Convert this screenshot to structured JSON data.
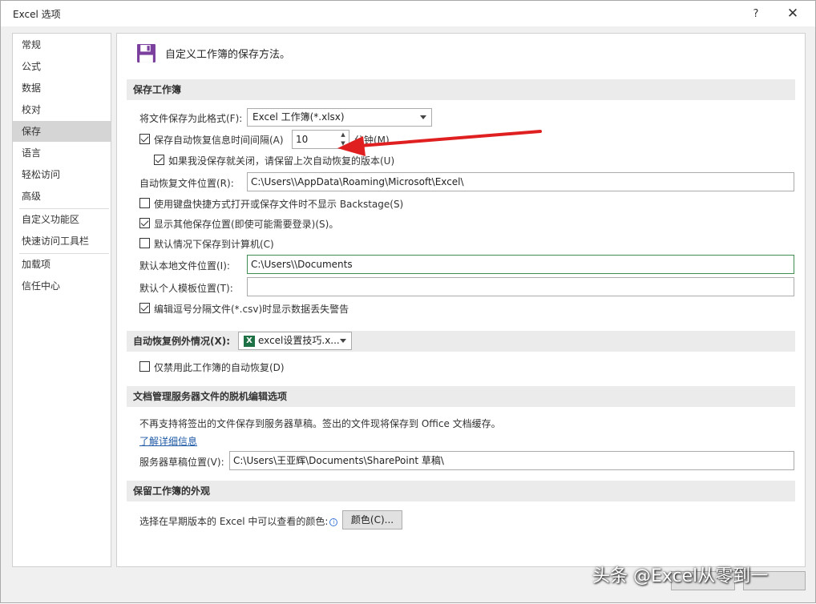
{
  "window": {
    "title": "Excel 选项",
    "help_label": "?",
    "close_label": "✕"
  },
  "nav": {
    "items": [
      {
        "label": "常规"
      },
      {
        "label": "公式"
      },
      {
        "label": "数据"
      },
      {
        "label": "校对"
      },
      {
        "label": "保存",
        "active": true
      },
      {
        "label": "语言"
      },
      {
        "label": "轻松访问"
      },
      {
        "label": "高级"
      },
      {
        "label": "自定义功能区"
      },
      {
        "label": "快速访问工具栏"
      },
      {
        "label": "加载项"
      },
      {
        "label": "信任中心"
      }
    ]
  },
  "main": {
    "heading": "自定义工作簿的保存方法。",
    "save_workbooks": {
      "title": "保存工作簿",
      "format_label": "将文件保存为此格式(F):",
      "format_value": "Excel 工作簿(*.xlsx)",
      "autorecover_label": "保存自动恢复信息时间间隔(A)",
      "autorecover_checked": true,
      "autorecover_minutes": "10",
      "minutes_label": "分钟(M)",
      "keep_last_label": "如果我没保存就关闭，请保留上次自动恢复的版本(U)",
      "keep_last_checked": true,
      "autorecover_location_label": "自动恢复文件位置(R):",
      "autorecover_location_value": "C:\\Users\\\\AppData\\Roaming\\Microsoft\\Excel\\",
      "no_backstage_label": "使用键盘快捷方式打开或保存文件时不显示 Backstage(S)",
      "no_backstage_checked": false,
      "show_additional_label": "显示其他保存位置(即使可能需要登录)(S)。",
      "show_additional_checked": true,
      "save_to_computer_label": "默认情况下保存到计算机(C)",
      "save_to_computer_checked": false,
      "default_local_label": "默认本地文件位置(I):",
      "default_local_value": "C:\\Users\\\\Documents",
      "default_template_label": "默认个人模板位置(T):",
      "default_template_value": "",
      "csv_warning_label": "编辑逗号分隔文件(*.csv)时显示数据丢失警告",
      "csv_warning_checked": true
    },
    "autorecover_exceptions": {
      "title": "自动恢复例外情况(X):",
      "workbook_value": "excel设置技巧.x...",
      "workbook_icon": "excel-file-icon",
      "disable_label": "仅禁用此工作簿的自动恢复(D)",
      "disable_checked": false
    },
    "offline_editing": {
      "title": "文档管理服务器文件的脱机编辑选项",
      "description": "不再支持将签出的文件保存到服务器草稿。签出的文件现将保存到 Office 文档缓存。",
      "learn_more": "了解详细信息",
      "drafts_label": "服务器草稿位置(V):",
      "drafts_value": "C:\\Users\\王亚辉\\Documents\\SharePoint 草稿\\"
    },
    "appearance": {
      "title": "保留工作簿的外观",
      "colors_label": "选择在早期版本的 Excel 中可以查看的颜色:",
      "colors_button": "颜色(C)..."
    }
  },
  "watermark": "头条 @Excel从零到一",
  "colors": {
    "annotation_arrow": "#e02020",
    "save_icon": "#7b3f9e",
    "excel_green": "#1e7145"
  }
}
